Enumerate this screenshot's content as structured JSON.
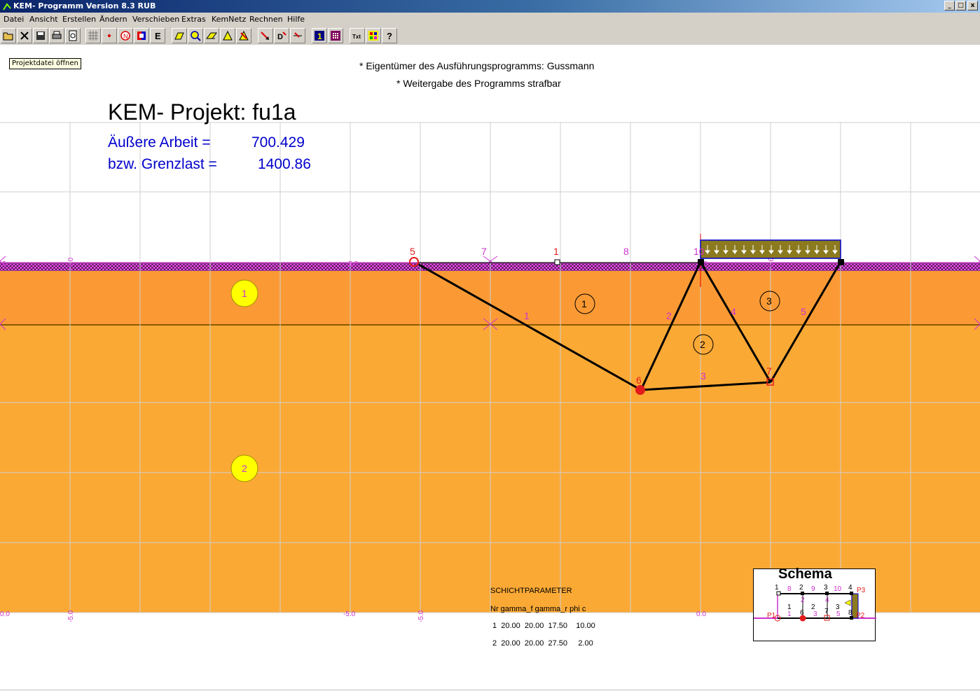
{
  "window": {
    "title": "KEM- Programm Version 8.3 RUB",
    "controls": [
      "_",
      "□",
      "x"
    ]
  },
  "menu": [
    "Datei",
    "Ansicht",
    "Erstellen",
    "Ändern",
    "Verschieben",
    "Extras",
    "KemNetz",
    "Rechnen",
    "Hilfe"
  ],
  "toolbar": {
    "tooltip": "Projektdatei öffnen",
    "buttons": [
      {
        "name": "open-file",
        "label": ""
      },
      {
        "name": "close-file",
        "label": ""
      },
      {
        "name": "save-file",
        "label": ""
      },
      {
        "name": "print",
        "label": ""
      },
      {
        "name": "print-preview",
        "label": ""
      },
      {
        "name": "grid",
        "label": ""
      },
      {
        "name": "snap-point",
        "label": ""
      },
      {
        "name": "node-mode",
        "label": "N"
      },
      {
        "name": "layer-colors",
        "label": ""
      },
      {
        "name": "elasticity",
        "label": "E"
      },
      {
        "name": "parallelogram",
        "label": ""
      },
      {
        "name": "zoom",
        "label": ""
      },
      {
        "name": "slope",
        "label": ""
      },
      {
        "name": "angle",
        "label": ""
      },
      {
        "name": "arrow-tool",
        "label": ""
      },
      {
        "name": "move-element",
        "label": ""
      },
      {
        "name": "delete-node",
        "label": "D"
      },
      {
        "name": "load-tool",
        "label": ""
      },
      {
        "name": "view-one",
        "label": "1"
      },
      {
        "name": "matrix-view",
        "label": ""
      },
      {
        "name": "text-tool",
        "label": "Txt"
      },
      {
        "name": "palette",
        "label": ""
      },
      {
        "name": "help-cursor",
        "label": "?"
      }
    ]
  },
  "header": {
    "owner_line1": "* Eigentümer des Ausführungsprogramms: Gussmann",
    "owner_line2": "* Weitergabe des Programms strafbar"
  },
  "project": {
    "title": "KEM- Projekt: fu1a",
    "work_label": "Äußere Arbeit =",
    "work_value": "700.429",
    "limit_label": "bzw. Grenzlast =",
    "limit_value": "1400.86"
  },
  "axes": {
    "top_ticks": [
      "0",
      "-5.0",
      "-5.0",
      "0.0",
      "-5.0"
    ],
    "bottom_ticks": [
      "0.0",
      "-5.0",
      "-5.0",
      "-5.0",
      "0.0"
    ]
  },
  "layers": [
    {
      "id": "1",
      "color": "#fb9a34"
    },
    {
      "id": "2",
      "color": "#fba935"
    }
  ],
  "mesh": {
    "nodes": [
      "5",
      "6",
      "7",
      "10",
      "1",
      "7",
      "8"
    ],
    "bars": [
      "1",
      "2",
      "3",
      "4",
      "5"
    ],
    "blocks": [
      "1",
      "2",
      "3"
    ]
  },
  "schicht": {
    "title": "SCHICHTPARAMETER",
    "header": "Nr gamma_f gamma_r phi c",
    "rows": [
      "1  20.00  20.00  17.50    10.00",
      "2  20.00  20.00  27.50     2.00"
    ]
  },
  "schema": {
    "title": "Schema",
    "labels": {
      "p1": "P1",
      "p2": "P2",
      "p3": "P3",
      "top": [
        "1",
        "8",
        "2",
        "9",
        "3",
        "10",
        "4"
      ],
      "mid": [
        "1",
        "2",
        "3"
      ],
      "bot": [
        "1",
        "6",
        "3",
        "7",
        "5",
        "8"
      ],
      "vert": [
        "2",
        "4"
      ]
    }
  },
  "colors": {
    "accent_blue": "#0000cc",
    "magenta": "#cc33cc",
    "node_red": "#e41b1b"
  }
}
